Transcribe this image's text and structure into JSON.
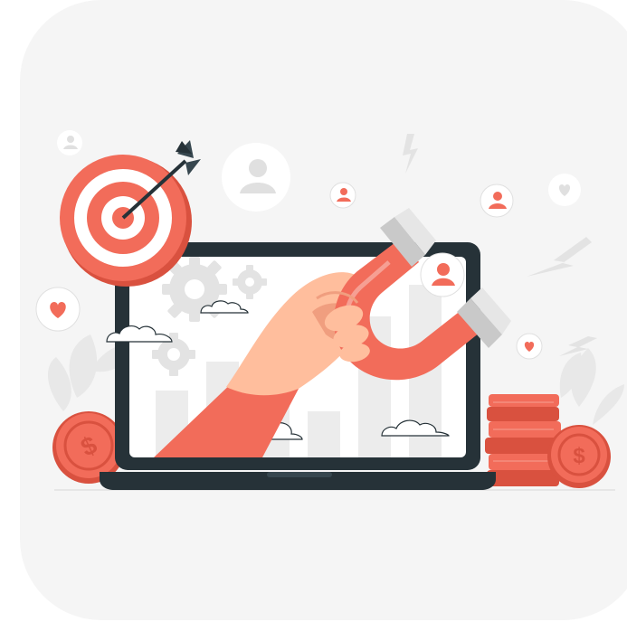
{
  "illustration": {
    "subject": "magnet-attracting-customers",
    "colors": {
      "background_card": "#f5f5f5",
      "accent": "#f26c5a",
      "accent_dark": "#d9513f",
      "accent_light": "#f7a393",
      "laptop_frame": "#263238",
      "screen": "#ffffff",
      "gray": "#e0e0e0",
      "gray_dark": "#c7c7c7",
      "skin": "#ffbe9d",
      "skin_dark": "#f09e7f",
      "magnet_tip": "#c9c9c9"
    },
    "icons": [
      "target-icon",
      "arrow-icon",
      "magnet-icon",
      "hand-icon",
      "laptop-icon",
      "gear-icon",
      "cloud-icon",
      "bar-chart-icon",
      "coin-icon",
      "coin-stack-icon",
      "user-icon",
      "heart-icon",
      "lightning-icon",
      "leaf-icon"
    ]
  }
}
